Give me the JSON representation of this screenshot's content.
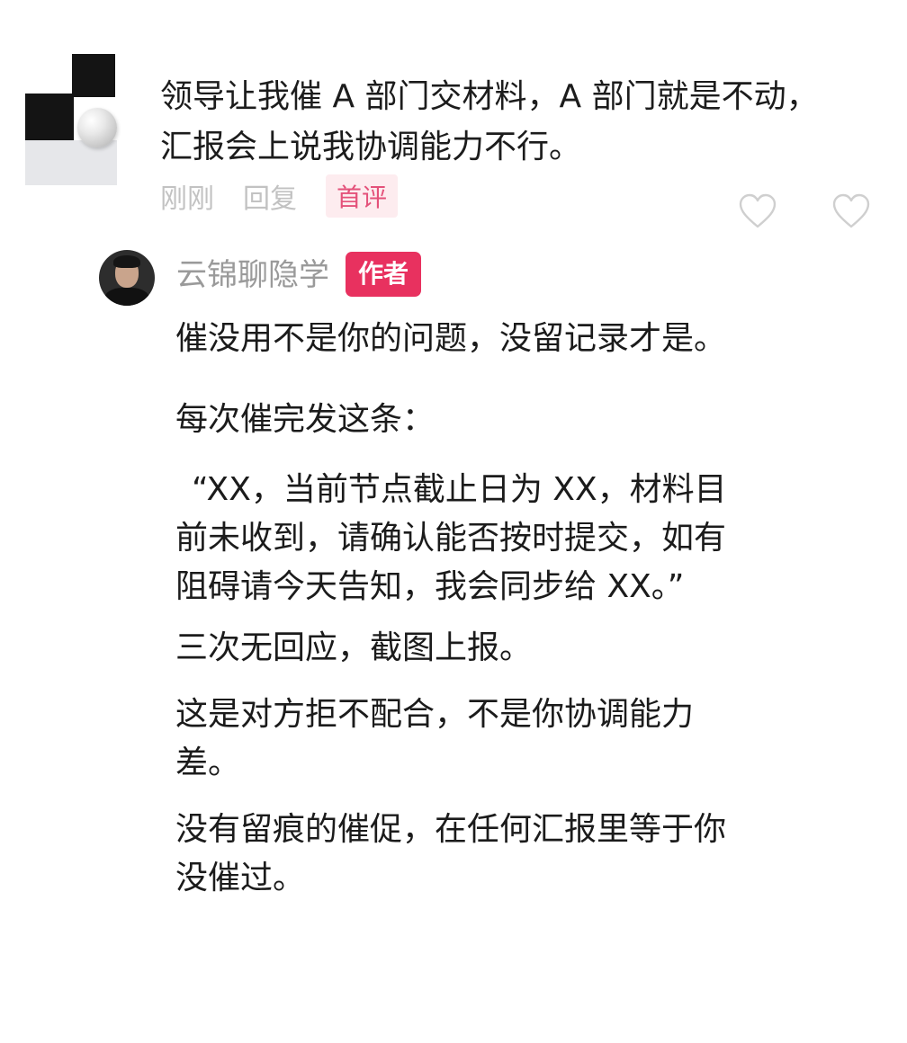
{
  "comment": {
    "avatar_icon": "abstract-blocks-avatar-icon",
    "line1": "领导让我催 A 部门交材料，A 部门就是不动，",
    "line2": "汇报会上说我协调能力不行。",
    "time": "刚刚",
    "reply_label": "回复",
    "first_tag": "首评",
    "like_icon": "heart-outline-icon"
  },
  "reply": {
    "author_name": "云锦聊隐学",
    "author_badge": "作者",
    "paragraphs": [
      [
        "催没用不是你的问题，没留记录才是。"
      ],
      [
        "每次催完发这条："
      ],
      [
        "“XX，当前节点截止日为 XX，材料目",
        "前未收到，请确认能否按时提交，如有",
        "阻碍请今天告知，我会同步给 XX。”"
      ],
      [
        "三次无回应，截图上报。"
      ],
      [
        "这是对方拒不配合，不是你协调能力",
        "差。"
      ],
      [
        "没有留痕的催促，在任何汇报里等于你",
        "没催过。"
      ]
    ]
  },
  "colors": {
    "badge": "#e8315f",
    "first_tag_text": "#e4517a",
    "meta_text": "#c2c2c2",
    "name_text": "#9a9a9a"
  }
}
